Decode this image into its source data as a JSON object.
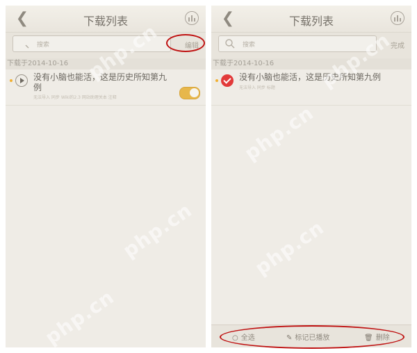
{
  "watermark": "php.cn",
  "left_screen": {
    "nav": {
      "title": "下载列表"
    },
    "search": {
      "placeholder": "搜索",
      "action": "编辑"
    },
    "section_date": "下载于2014-10-16",
    "item": {
      "title": "没有小脑也能活，这是历史所知第九例",
      "meta": "无法导入 同步 Wiki的2.3 网站助理关本 注释"
    }
  },
  "right_screen": {
    "nav": {
      "title": "下载列表"
    },
    "search": {
      "placeholder": "搜索",
      "action": "完成"
    },
    "section_date": "下载于2014-10-16",
    "item": {
      "title": "没有小脑也能活，这是历史所知第九例",
      "meta": "无法导入 同步 标题"
    },
    "toolbar": {
      "select_all": "全选",
      "mark_played": "标记已播放",
      "delete": "删除"
    }
  },
  "colors": {
    "annotation": "#bf1111",
    "accent": "#e7b74b",
    "checked": "#e23a3a"
  }
}
